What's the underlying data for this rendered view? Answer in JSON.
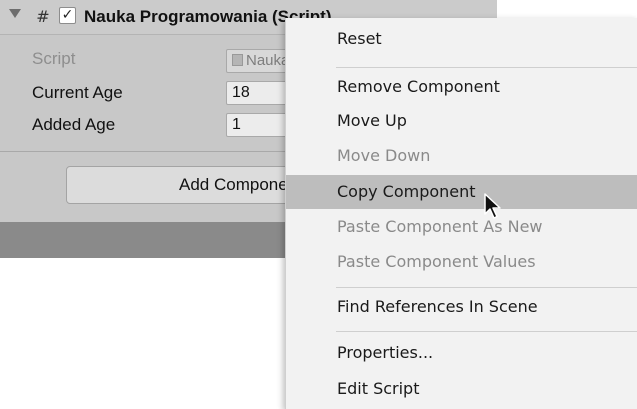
{
  "inspector": {
    "component_title": "Nauka Programowania (Script)",
    "enabled_check": "✓",
    "script_icon": "#",
    "rows": [
      {
        "label": "Script",
        "value": "Nauka"
      },
      {
        "label": "Current Age",
        "value": "18"
      },
      {
        "label": "Added Age",
        "value": "1"
      }
    ],
    "add_component_label": "Add Component"
  },
  "context_menu": {
    "items": [
      {
        "label": "Reset",
        "enabled": true
      },
      {
        "label": "Remove Component",
        "enabled": true
      },
      {
        "label": "Move Up",
        "enabled": true
      },
      {
        "label": "Move Down",
        "enabled": false
      },
      {
        "label": "Copy Component",
        "enabled": true,
        "highlighted": true
      },
      {
        "label": "Paste Component As New",
        "enabled": false
      },
      {
        "label": "Paste Component Values",
        "enabled": false
      },
      {
        "label": "Find References In Scene",
        "enabled": true
      },
      {
        "label": "Properties...",
        "enabled": true
      },
      {
        "label": "Edit Script",
        "enabled": true
      }
    ]
  },
  "colors": {
    "panel_bg": "#c8c8c8",
    "menu_bg": "#f2f2f2",
    "menu_highlight": "#bdbdbd",
    "disabled_text": "#8a8a8a"
  },
  "icons": {
    "foldout": "triangle-down-icon",
    "script": "hash-icon",
    "checkbox": "checkmark-icon",
    "cursor": "mouse-pointer-icon"
  }
}
